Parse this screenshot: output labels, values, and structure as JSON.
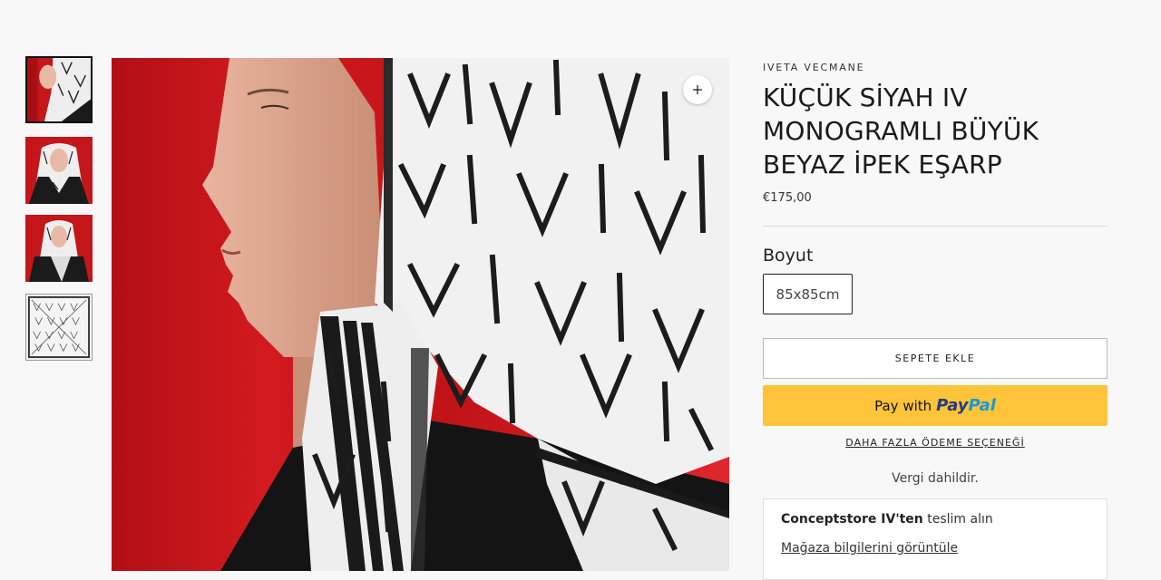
{
  "product": {
    "vendor": "IVETA VECMANE",
    "title": "KÜÇÜK SİYAH IV MONOGRAMLI BÜYÜK BEYAZ İPEK EŞARP",
    "price": "€175,00"
  },
  "gallery": {
    "thumbnails": [
      {
        "label": "profile view"
      },
      {
        "label": "front view"
      },
      {
        "label": "wrapped view"
      },
      {
        "label": "flat pattern"
      }
    ],
    "zoom_icon": "plus-icon"
  },
  "options": {
    "label": "Boyut",
    "selected": "85x85cm"
  },
  "actions": {
    "add_to_cart": "SEPETE EKLE",
    "paypal_prefix": "Pay with",
    "paypal_brand_1": "Pay",
    "paypal_brand_2": "Pal",
    "more_payment": "DAHA FAZLA ÖDEME SEÇENEĞİ"
  },
  "tax_note": "Vergi dahildir.",
  "pickup": {
    "store": "Conceptstore IV'ten",
    "suffix": "teslim alın",
    "link": "Mağaza bilgilerini görüntüle"
  },
  "colors": {
    "background": "#f8f8f8",
    "paypal_yellow": "#ffc439",
    "photo_red": "#c91519"
  }
}
